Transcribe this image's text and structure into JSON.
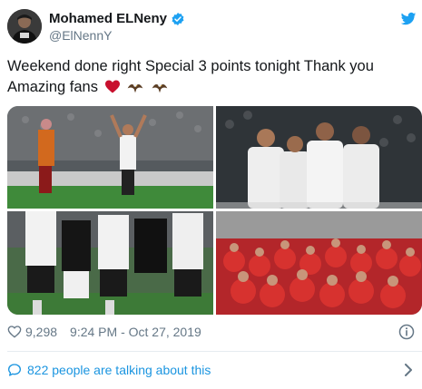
{
  "tweet": {
    "display_name": "Mohamed ELNeny",
    "handle": "@ElNennY",
    "text": "Weekend done right Special 3 points tonight Thank you Amazing fans",
    "emojis": [
      "red-heart",
      "eagle",
      "eagle"
    ],
    "likes": "9,298",
    "timestamp": "9:24 PM - Oct 27, 2019",
    "talking": "822 people are talking about this"
  },
  "colors": {
    "text": "#14171a",
    "muted": "#657786",
    "link": "#1b95e0",
    "twitter_blue": "#1da1f2",
    "divider": "#e6ecf0"
  },
  "media": [
    {
      "alt_kind": "player celebrating on pitch"
    },
    {
      "alt_kind": "players in white shirts walking"
    },
    {
      "alt_kind": "players in black and white kits"
    },
    {
      "alt_kind": "team group photo in red"
    }
  ]
}
